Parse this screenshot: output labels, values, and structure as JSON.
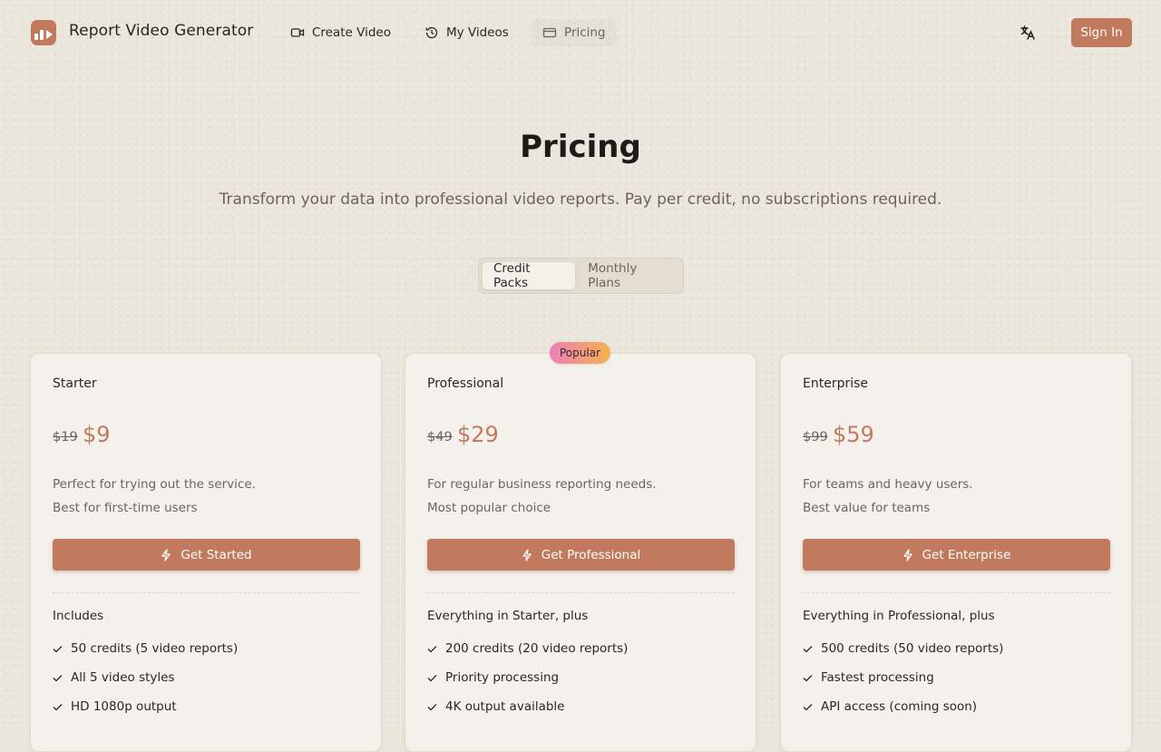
{
  "app": {
    "brand": "Report Video Generator"
  },
  "nav": {
    "create": "Create Video",
    "videos": "My Videos",
    "pricing": "Pricing",
    "sign_in": "Sign In"
  },
  "hero": {
    "title": "Pricing",
    "subtitle": "Transform your data into professional video reports. Pay per credit, no subscriptions required."
  },
  "toggle": {
    "credit_packs": "Credit Packs",
    "monthly_plans": "Monthly Plans",
    "selected": "Credit Packs"
  },
  "badge": "Popular",
  "plans": [
    {
      "name": "Starter",
      "old_price": "$19",
      "price": "$9",
      "description": "Perfect for trying out the service.",
      "note": "Best for first-time users",
      "cta": "Get Started",
      "includes": "Includes",
      "features": [
        "50 credits (5 video reports)",
        "All 5 video styles",
        "HD 1080p output"
      ]
    },
    {
      "name": "Professional",
      "old_price": "$49",
      "price": "$29",
      "description": "For regular business reporting needs.",
      "note": "Most popular choice",
      "cta": "Get Professional",
      "includes": "Everything in Starter, plus",
      "features": [
        "200 credits (20 video reports)",
        "Priority processing",
        "4K output available"
      ]
    },
    {
      "name": "Enterprise",
      "old_price": "$99",
      "price": "$59",
      "description": "For teams and heavy users.",
      "note": "Best value for teams",
      "cta": "Get Enterprise",
      "includes": "Everything in Professional, plus",
      "features": [
        "500 credits (50 video reports)",
        "Fastest processing",
        "API access (coming soon)"
      ]
    }
  ],
  "colors": {
    "accent": "#c27a5e",
    "background": "#ebe6dc",
    "card": "#f4f1ec"
  }
}
